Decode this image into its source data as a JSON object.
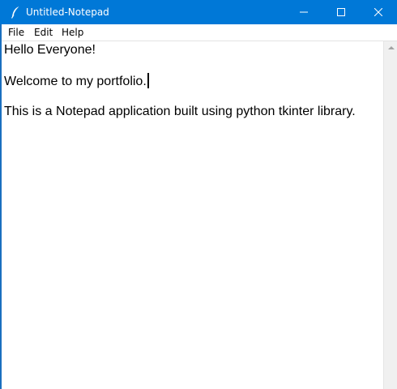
{
  "window": {
    "title": "Untitled-Notepad",
    "accent_color": "#0078d7",
    "controls": [
      "minimize-icon",
      "maximize-icon",
      "close-icon"
    ]
  },
  "menubar": {
    "items": [
      {
        "label": "File"
      },
      {
        "label": "Edit"
      },
      {
        "label": "Help"
      }
    ]
  },
  "editor": {
    "lines": [
      "Hello Everyone!",
      "Welcome to my portfolio.",
      "This is a Notepad application built using python tkinter library."
    ]
  }
}
